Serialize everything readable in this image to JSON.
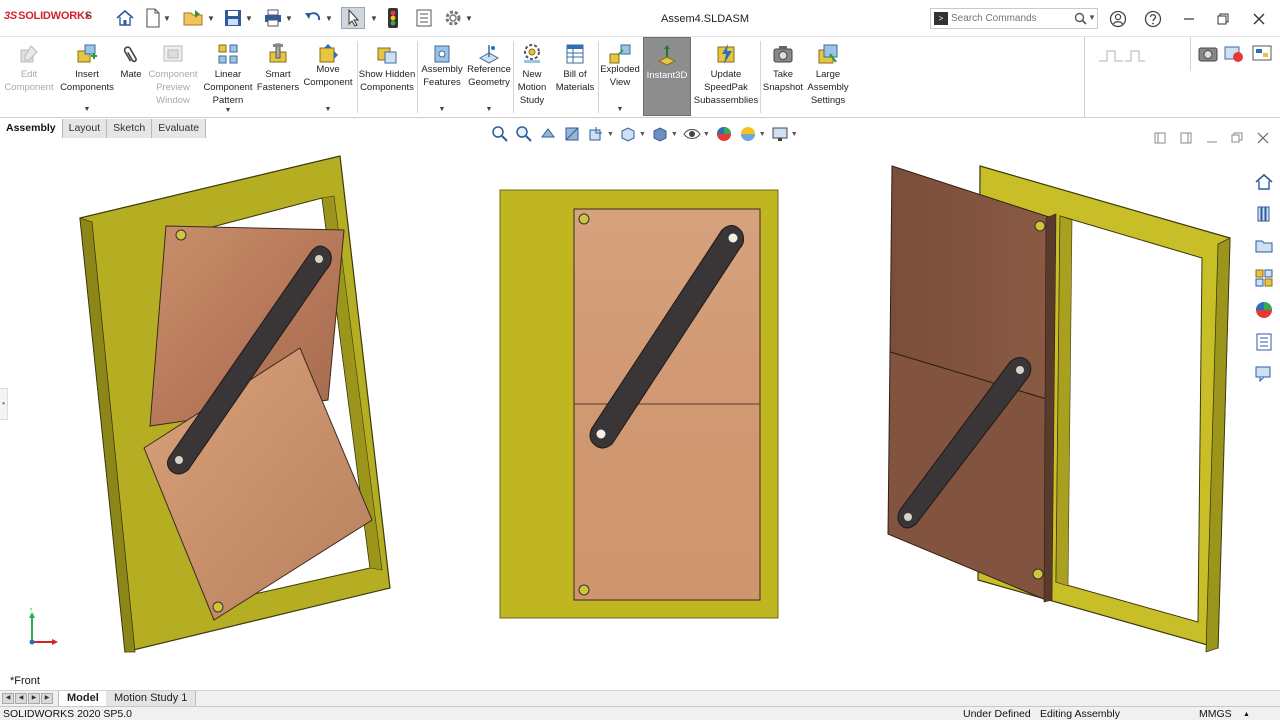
{
  "app": {
    "brand": "SOLIDWORKS",
    "brand_mark": "3S",
    "document_title": "Assem4.SLDASM"
  },
  "search": {
    "placeholder": "Search Commands"
  },
  "quick_access": {
    "icons": [
      "home-icon",
      "new-document-icon",
      "open-folder-icon",
      "save-icon",
      "print-icon",
      "undo-icon",
      "select-arrow-icon",
      "rebuild-traffic-light-icon",
      "file-properties-icon",
      "options-gear-icon"
    ]
  },
  "ribbon": {
    "edit_component": "Edit Component",
    "insert_components": "Insert Components",
    "mate": "Mate",
    "component_preview_window": "Component Preview Window",
    "linear_component_pattern": "Linear Component Pattern",
    "smart_fasteners": "Smart Fasteners",
    "move_component": "Move Component",
    "show_hidden_components": "Show Hidden Components",
    "assembly_features": "Assembly Features",
    "reference_geometry": "Reference Geometry",
    "new_motion_study": "New Motion Study",
    "bill_of_materials": "Bill of Materials",
    "exploded_view": "Exploded View",
    "instant3d": "Instant3D",
    "update_speedpak": "Update SpeedPak Subassemblies",
    "take_snapshot": "Take Snapshot",
    "large_assembly_settings": "Large Assembly Settings"
  },
  "tabs": [
    "Assembly",
    "Layout",
    "Sketch",
    "Evaluate"
  ],
  "viewport": {
    "view_label": "*Front",
    "triad_y": "Y"
  },
  "bottom_tabs": [
    "Model",
    "Motion Study 1"
  ],
  "status": {
    "version": "SOLIDWORKS 2020 SP5.0",
    "definition": "Under Defined",
    "mode": "Editing Assembly",
    "units": "MMGS"
  },
  "colors": {
    "frame_yellow": "#b7ae1f",
    "frame_yellow_dark": "#7f7a10",
    "wood_light": "#d49a6e",
    "wood_dark": "#7a4e38",
    "link_bar": "#3a3536",
    "brand_red": "#d2232a"
  }
}
